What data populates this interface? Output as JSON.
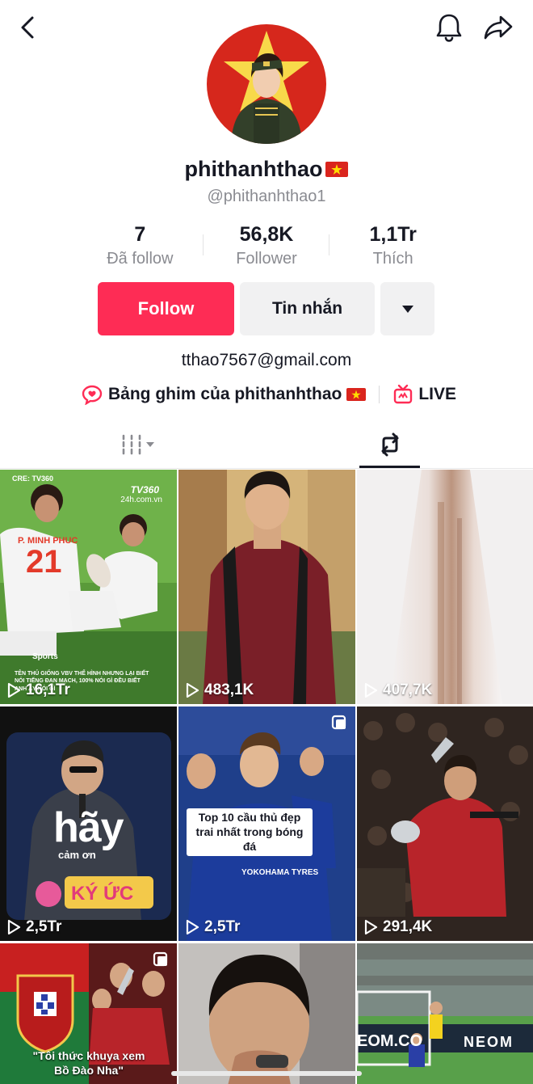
{
  "profile": {
    "username": "phithanhthao",
    "handle": "@phithanhthao1",
    "bio": "tthao7567@gmail.com"
  },
  "stats": [
    {
      "value": "7",
      "label": "Đã follow"
    },
    {
      "value": "56,8K",
      "label": "Follower"
    },
    {
      "value": "1,1Tr",
      "label": "Thích"
    }
  ],
  "actions": {
    "follow": "Follow",
    "message": "Tin nhắn"
  },
  "links": {
    "playlist": "Bảng ghim của phithanhthao",
    "live": "LIVE"
  },
  "videos": [
    {
      "views": "16,1Tr",
      "caption": "",
      "top_label": "CRE: TV360",
      "brand": "TV360",
      "domain": "24h.com.vn",
      "sports": "Sports",
      "overlay": "TÊN THỦ GIỐNG VBV THỂ HÌNH NHƯNG LẠI BIẾT NÓI TIẾNG ĐAN MẠCH, 100% NÓI GÌ ĐỀU BIẾT ANH ẤY NÓI GÌ",
      "jersey_name": "P. MINH PHUC",
      "jersey_number": "21"
    },
    {
      "views": "483,1K",
      "caption": ""
    },
    {
      "views": "407,7K",
      "caption": ""
    },
    {
      "views": "2,5Tr",
      "caption": "",
      "big_text": "hãy",
      "small_text": "cảm ơn",
      "logo_text": "KÝ ỨC"
    },
    {
      "views": "2,5Tr",
      "caption": "Top 10 cầu thủ đẹp trai nhất trong bóng đá",
      "sponsor": "YOKOHAMA TYRES"
    },
    {
      "views": "291,4K",
      "caption": ""
    },
    {
      "views": "",
      "caption": "\"Tôi thức khuya xem Bồ Đào Nha\""
    },
    {
      "views": "",
      "caption": ""
    },
    {
      "views": "",
      "caption": "",
      "board": "EOM.CO",
      "board2": "NEOM"
    }
  ],
  "colors": {
    "accent": "#fe2c55",
    "muted": "#8a8b91"
  }
}
